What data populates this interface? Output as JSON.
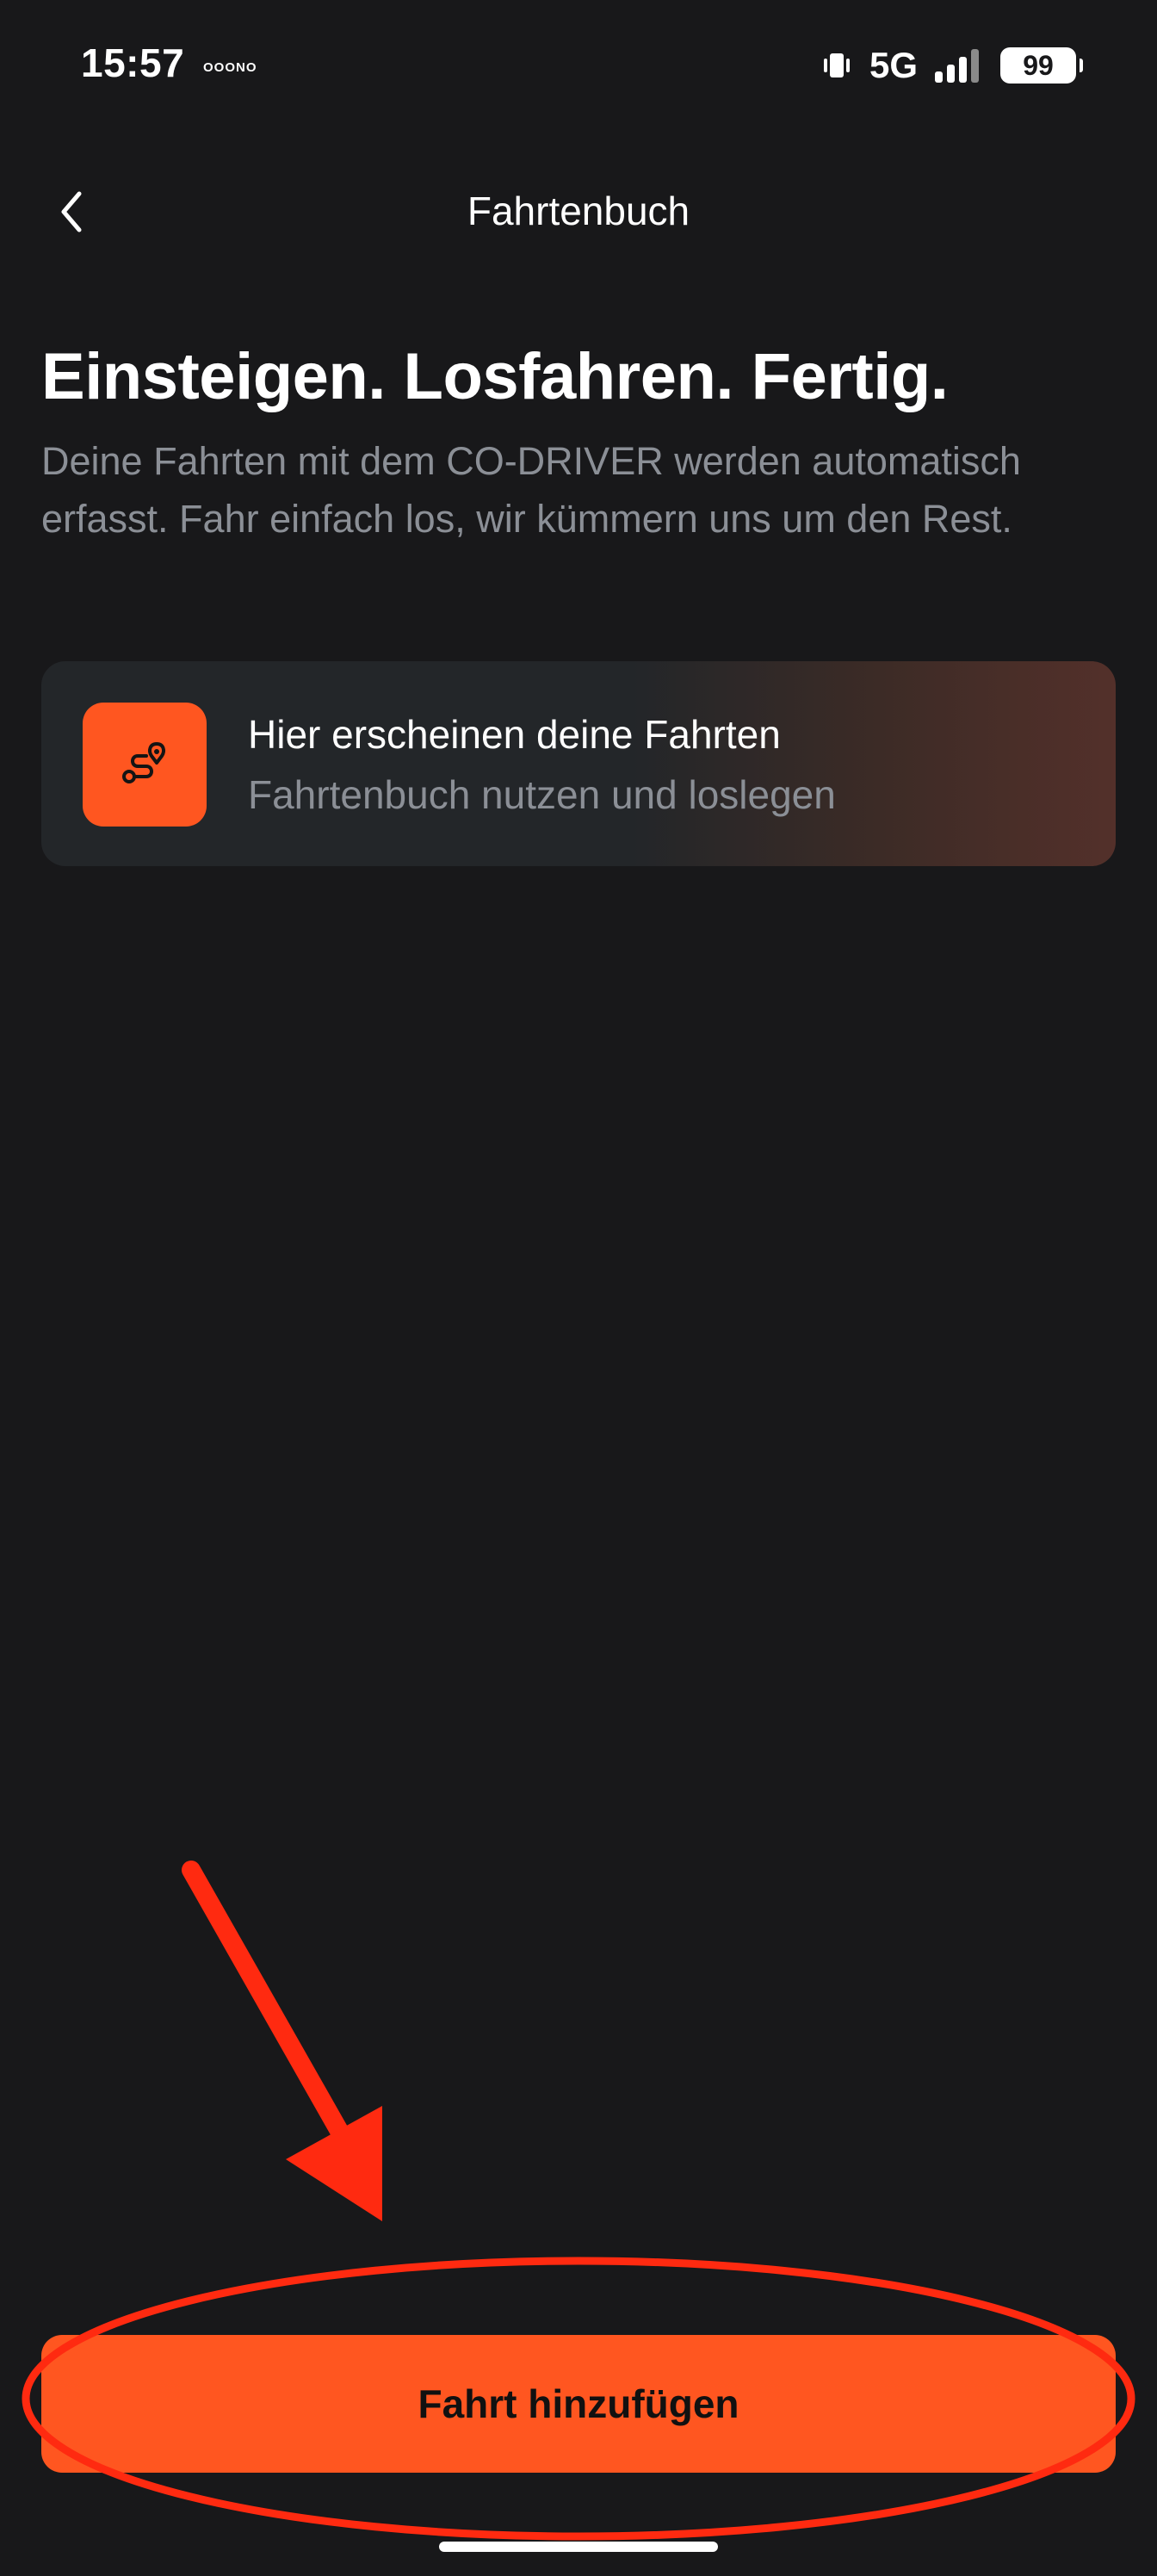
{
  "status_bar": {
    "time": "15:57",
    "carrier": "OOONO",
    "network": "5G",
    "battery": "99",
    "icons": [
      "vibrate-icon",
      "signal-icon",
      "battery-icon"
    ]
  },
  "header": {
    "title": "Fahrtenbuch",
    "back_icon": "chevron-left-icon"
  },
  "hero": {
    "title": "Einsteigen. Losfahren. Fertig.",
    "description": "Deine Fahrten mit dem CO-DRIVER werden automatisch erfasst. Fahr einfach los, wir kümmern uns um den Rest."
  },
  "empty_state": {
    "icon": "route-icon",
    "title": "Hier erscheinen deine Fahrten",
    "subtitle": "Fahrtenbuch nutzen und loslegen"
  },
  "primary_action": {
    "label": "Fahrt hinzufügen"
  },
  "annotation": {
    "shapes": [
      "arrow",
      "ellipse"
    ],
    "color": "#ff2a10"
  },
  "colors": {
    "background": "#18181a",
    "accent": "#ff5620",
    "muted_text": "#8b8f96",
    "card": "#232629"
  }
}
